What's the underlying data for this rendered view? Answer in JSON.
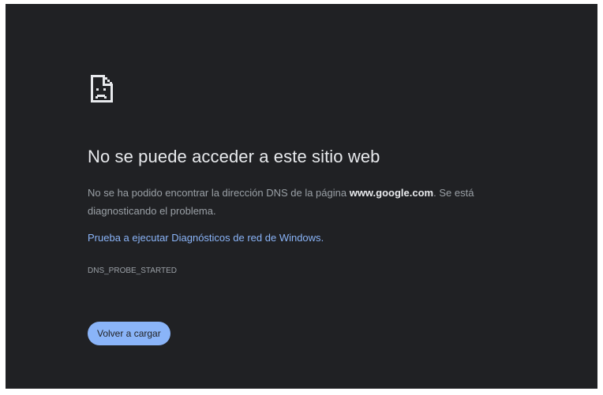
{
  "error_page": {
    "icon": "sad-page-icon",
    "title": "No se puede acceder a este sitio web",
    "description_before": "No se ha podido encontrar la dirección DNS de la página ",
    "host": "www.google.com",
    "description_after": ". Se está diagnosticando el problema.",
    "suggestion_prefix": "Prueba a ",
    "suggestion_link": "ejecutar Diagnósticos de red de Windows",
    "suggestion_suffix": ".",
    "error_code": "DNS_PROBE_STARTED",
    "reload_label": "Volver a cargar"
  },
  "colors": {
    "background": "#202124",
    "title": "#e8eaed",
    "body_text": "#9aa0a6",
    "link": "#8ab4f8",
    "button": "#8ab4f8"
  }
}
